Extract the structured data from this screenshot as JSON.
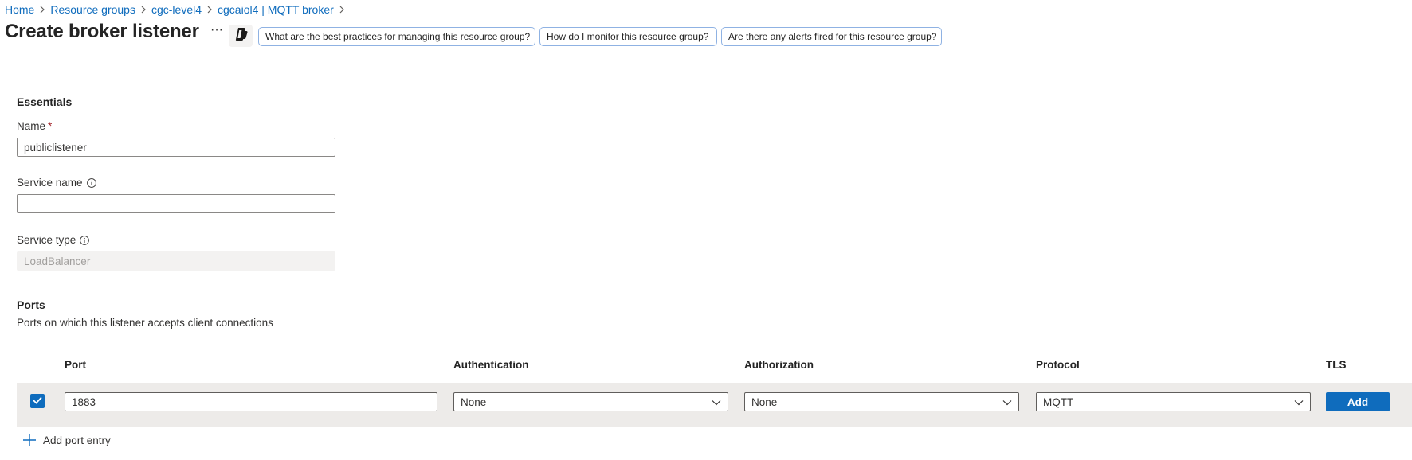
{
  "breadcrumb": [
    "Home",
    "Resource groups",
    "cgc-level4",
    "cgcaiol4 | MQTT broker"
  ],
  "page": {
    "title": "Create broker listener",
    "more_label": "···"
  },
  "suggestions": [
    "What are the best practices for managing this resource group?",
    "How do I monitor this resource group?",
    "Are there any alerts fired for this resource group?"
  ],
  "essentials": {
    "title": "Essentials",
    "name_label": "Name",
    "name_required": "*",
    "name_value": "publiclistener",
    "service_name_label": "Service name",
    "service_name_value": "",
    "service_type_label": "Service type",
    "service_type_value": "LoadBalancer"
  },
  "ports": {
    "title": "Ports",
    "description": "Ports on which this listener accepts client connections",
    "columns": [
      "Port",
      "Authentication",
      "Authorization",
      "Protocol",
      "TLS"
    ],
    "rows": [
      {
        "selected": true,
        "port": "1883",
        "authentication": "None",
        "authorization": "None",
        "protocol": "MQTT",
        "tls_button": "Add"
      }
    ],
    "add_entry_label": "Add port entry"
  },
  "colors": {
    "accent": "#0f6cbd",
    "row_bg": "#edebe9",
    "required": "#a4262c"
  },
  "icons": {
    "breadcrumb_separator": "chevron-right-icon",
    "copilot": "copilot-icon",
    "info": "info-icon",
    "dropdown": "chevron-down-icon",
    "checkbox": "checkmark-icon",
    "add": "plus-icon"
  }
}
